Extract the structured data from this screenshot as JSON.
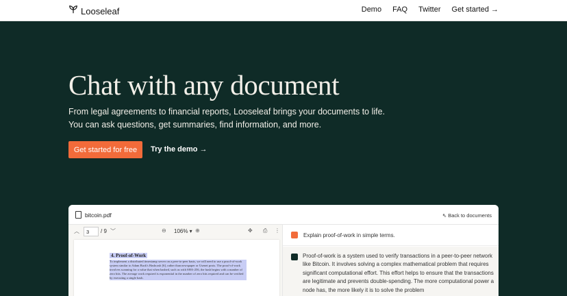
{
  "nav": {
    "brand": "Looseleaf",
    "links": [
      "Demo",
      "FAQ",
      "Twitter",
      "Get started →"
    ]
  },
  "hero": {
    "title": "Chat with any document",
    "subtitle_line1": "From legal agreements to financial reports, Looseleaf brings your documents to life.",
    "subtitle_line2": "You can ask questions, get summaries, find information, and more.",
    "primary_cta": "Get started for free",
    "secondary_cta": "Try the demo →"
  },
  "app": {
    "file_name": "bitcoin.pdf",
    "back_link": "Back to documents",
    "toolbar": {
      "page_value": "3",
      "page_total": "/ 9",
      "zoom": "106% ▾"
    },
    "pdf": {
      "heading": "4.    Proof-of-Work",
      "body": "To implement a distributed timestamp server on a peer-to-peer basis, we will need to use a proof-of-work system similar to Adam Back's Hashcash [6], rather than newspaper or Usenet posts. The proof-of-work involves scanning for a value that when hashed, such as with SHA-256, the hash begins with a number of zero bits. The average work required is exponential in the number of zero bits required and can be verified by executing a single hash."
    },
    "chat": {
      "question": "Explain proof-of-work in simple terms.",
      "answer": "Proof-of-work is a system used to verify transactions in a peer-to-peer network like Bitcoin. It involves solving a complex mathematical problem that requires significant computational effort. This effort helps to ensure that the transactions are legitimate and prevents double-spending. The more computational power a node has, the more likely it is to solve the problem"
    }
  },
  "colors": {
    "background": "#0f2b27",
    "accent": "#f26b3a",
    "highlight": "#c8cdf5"
  }
}
